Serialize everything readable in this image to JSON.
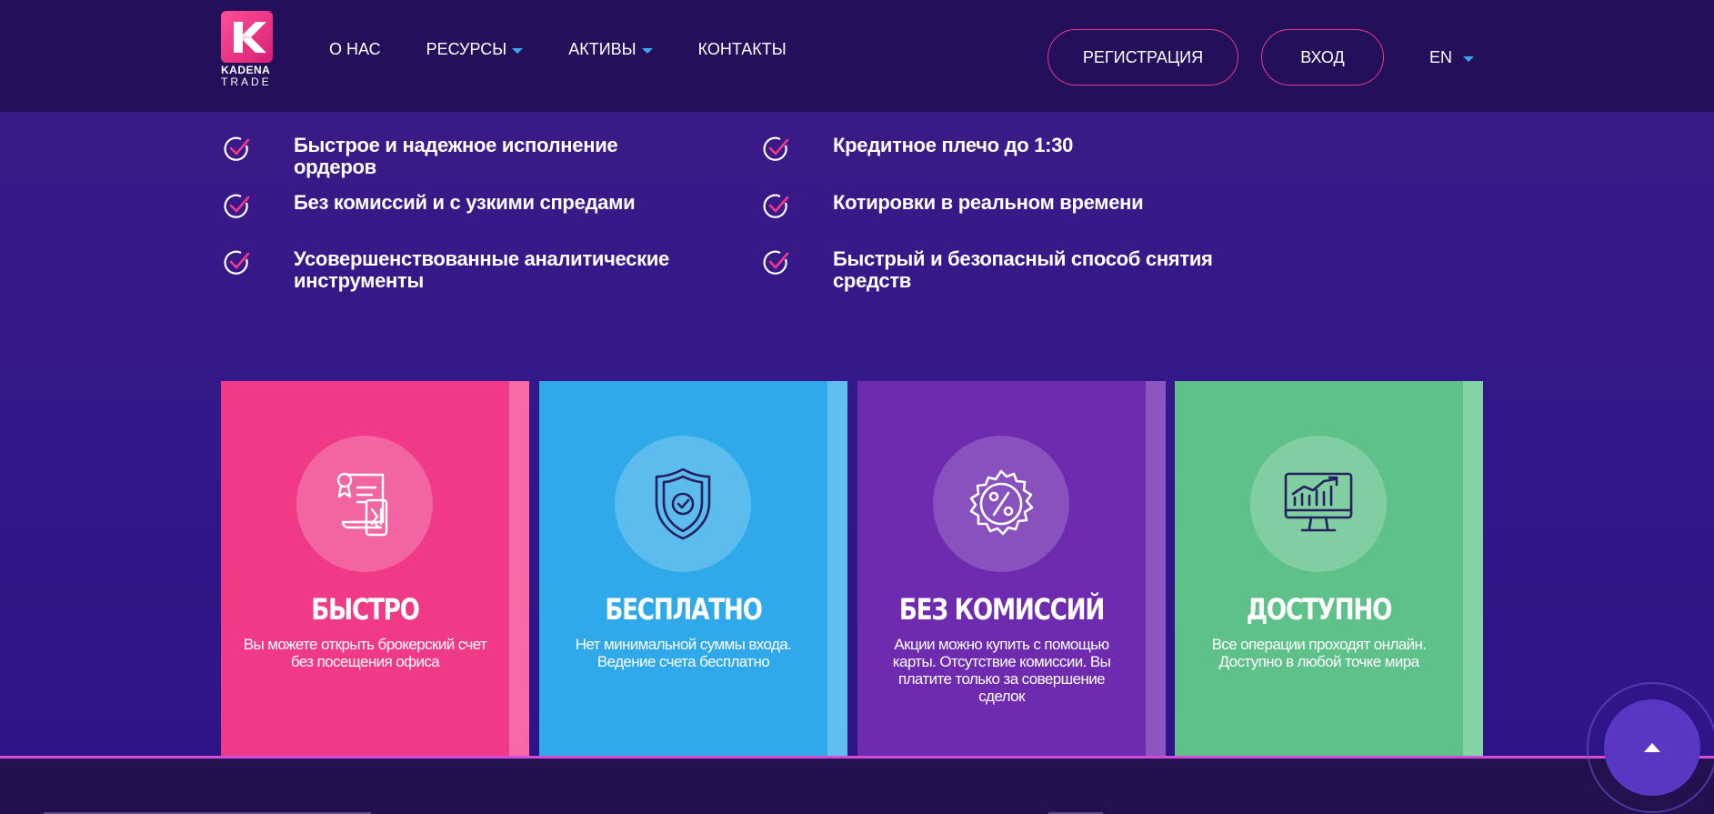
{
  "brand": {
    "line1": "KADENA",
    "line2": "TRADE",
    "accent": "#f03a88"
  },
  "nav": {
    "items": [
      {
        "label": "О НАС",
        "dropdown": false
      },
      {
        "label": "РЕСУРСЫ",
        "dropdown": true
      },
      {
        "label": "АКТИВЫ",
        "dropdown": true
      },
      {
        "label": "КОНТАКТЫ",
        "dropdown": false
      }
    ],
    "register_label": "РЕГИСТРАЦИЯ",
    "login_label": "ВХОД",
    "language": "EN"
  },
  "features": [
    "Быстрое и надежное исполнение ордеров",
    "Без комиссий и с узкими спредами",
    "Усовершенствованные аналитические инструменты",
    "Кредитное плечо до 1:30",
    "Котировки в реальном времени",
    "Быстрый и безопасный способ снятия средств"
  ],
  "cards": [
    {
      "title": "БЫСТРО",
      "text": "Вы можете открыть брокерский счет без посещения офиса",
      "icon": "contract-document-icon",
      "color": "#f03a88"
    },
    {
      "title": "БЕСПЛАТНО",
      "text": "Нет минимальной суммы входа. Ведение счета бесплатно",
      "icon": "shield-check-icon",
      "color": "#2fa9ea"
    },
    {
      "title": "БЕЗ КОМИССИЙ",
      "text": "Акции можно купить с помощью карты. Отсутствие комиссии. Вы платите только за совершение сделок",
      "icon": "percent-badge-icon",
      "color": "#6e2bb0"
    },
    {
      "title": "ДОСТУПНО",
      "text": "Все операции проходят онлайн. Доступно в любой точке мира",
      "icon": "monitor-chart-icon",
      "color": "#5ec189"
    }
  ],
  "scroll_top": {
    "icon": "arrow-up-icon"
  }
}
